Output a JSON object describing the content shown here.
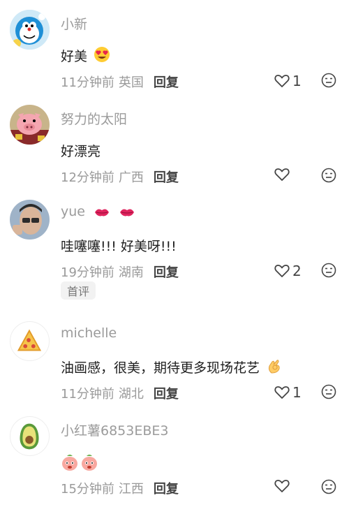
{
  "comments": [
    {
      "username": "小新",
      "text": "好美",
      "emoji": "heart-eyes-emoji",
      "time": "11分钟前",
      "location": "英国",
      "reply_label": "回复",
      "likes": "1",
      "avatar": "doraemon-avatar"
    },
    {
      "username": "努力的太阳",
      "text": "好漂亮",
      "time": "12分钟前",
      "location": "广西",
      "reply_label": "回复",
      "likes": "",
      "avatar": "pig-avatar"
    },
    {
      "username": "yue",
      "username_emoji": "lips-emoji",
      "text": "哇噻噻!!!  好美呀!!!",
      "time": "19分钟前",
      "location": "湖南",
      "reply_label": "回复",
      "likes": "2",
      "badge": "首评",
      "avatar": "person-avatar"
    },
    {
      "username": "michelle",
      "text": "油画感，很美，期待更多现场花艺",
      "emoji": "ok-hand-emoji",
      "time": "11分钟前",
      "location": "湖北",
      "reply_label": "回复",
      "likes": "1",
      "avatar": "pizza-avatar"
    },
    {
      "username": "小红薯6853EBE3",
      "text": "",
      "emoji": "peach-face-emoji",
      "time": "15分钟前",
      "location": "江西",
      "reply_label": "回复",
      "likes": "",
      "avatar": "avocado-avatar"
    }
  ],
  "colors": {
    "username": "#9b9b9b",
    "meta": "#9a9a9a",
    "text": "#1f1f1f",
    "icon": "#444444"
  }
}
